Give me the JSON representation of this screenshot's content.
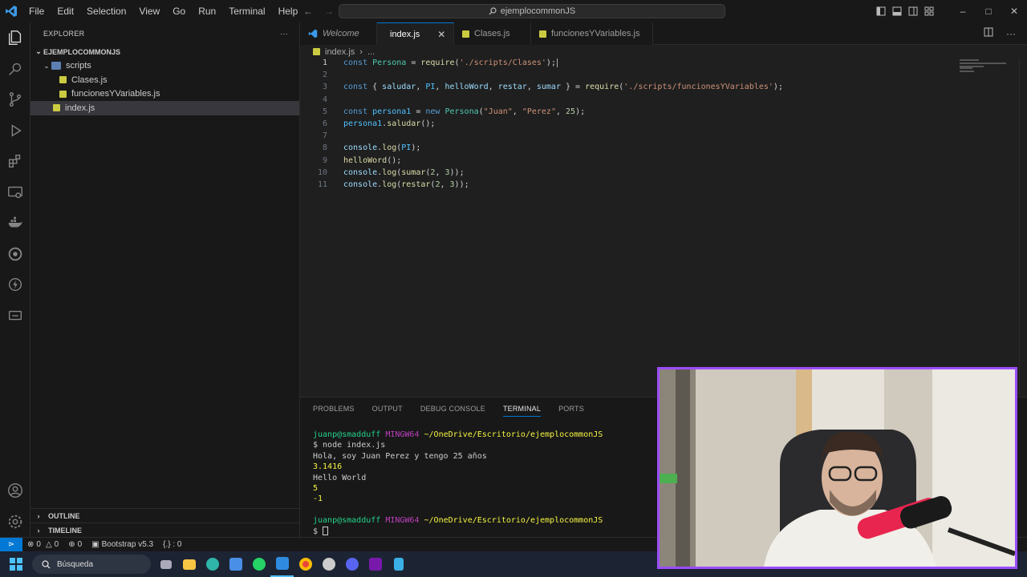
{
  "titlebar": {
    "menu": [
      "File",
      "Edit",
      "Selection",
      "View",
      "Go",
      "Run",
      "Terminal",
      "Help"
    ],
    "search_text": "ejemplocommonJS"
  },
  "explorer": {
    "header": "EXPLORER",
    "more": "···",
    "project": "EJEMPLOCOMMONJS",
    "folder": "scripts",
    "files_in_scripts": [
      "Clases.js",
      "funcionesYVariables.js"
    ],
    "root_file": "index.js",
    "outline": "OUTLINE",
    "timeline": "TIMELINE"
  },
  "tabs": [
    {
      "label": "Welcome"
    },
    {
      "label": "index.js",
      "close": "✕"
    },
    {
      "label": "Clases.js"
    },
    {
      "label": "funcionesYVariables.js"
    }
  ],
  "breadcrumb": {
    "file": "index.js",
    "sep": "›",
    "rest": "..."
  },
  "code_lines": [
    {
      "n": "1"
    },
    {
      "n": "2"
    },
    {
      "n": "3"
    },
    {
      "n": "4"
    },
    {
      "n": "5"
    },
    {
      "n": "6"
    },
    {
      "n": "7"
    },
    {
      "n": "8"
    },
    {
      "n": "9"
    },
    {
      "n": "10"
    },
    {
      "n": "11"
    }
  ],
  "code": {
    "l1": [
      "const",
      " ",
      "Persona",
      " = ",
      "require",
      "(",
      "'./scripts/Clases'",
      ");"
    ],
    "l3": [
      "const",
      " { ",
      "saludar",
      ", ",
      "PI",
      ", ",
      "helloWord",
      ", ",
      "restar",
      ", ",
      "sumar",
      " } = ",
      "require",
      "(",
      "'./scripts/funcionesYVariables'",
      ");"
    ],
    "l5": [
      "const",
      " ",
      "persona1",
      " = ",
      "new",
      " ",
      "Persona",
      "(",
      "\"Juan\"",
      ", ",
      "\"Perez\"",
      ", ",
      "25",
      ");"
    ],
    "l6": [
      "persona1",
      ".",
      "saludar",
      "();"
    ],
    "l8": [
      "console",
      ".",
      "log",
      "(",
      "PI",
      ");"
    ],
    "l9": [
      "helloWord",
      "();"
    ],
    "l10": [
      "console",
      ".",
      "log",
      "(",
      "sumar",
      "(",
      "2",
      ", ",
      "3",
      "));"
    ],
    "l11": [
      "console",
      ".",
      "log",
      "(",
      "restar",
      "(",
      "2",
      ", ",
      "3",
      "));"
    ]
  },
  "panel": {
    "tabs": [
      "PROBLEMS",
      "OUTPUT",
      "DEBUG CONSOLE",
      "TERMINAL",
      "PORTS"
    ],
    "active_tab": "TERMINAL"
  },
  "terminal": {
    "user": "juanp@smadduff",
    "env": "MINGW64",
    "path": "~/OneDrive/Escritorio/ejemplocommonJS",
    "cmd": "$ node index.js",
    "out1": "Hola, soy Juan Perez y tengo 25 años",
    "out2": "3.1416",
    "out3": "Hello World",
    "out4": "5",
    "out5": "-1",
    "prompt": "$ "
  },
  "statusbar": {
    "errors": "0",
    "warnings": "0",
    "ports": "0",
    "bootstrap": "Bootstrap v5.3",
    "braces": "{.} : 0"
  },
  "taskbar": {
    "search_label": "Búsqueda"
  },
  "colors": {
    "accent": "#0078d4",
    "webcam_border": "#9b4dff"
  }
}
